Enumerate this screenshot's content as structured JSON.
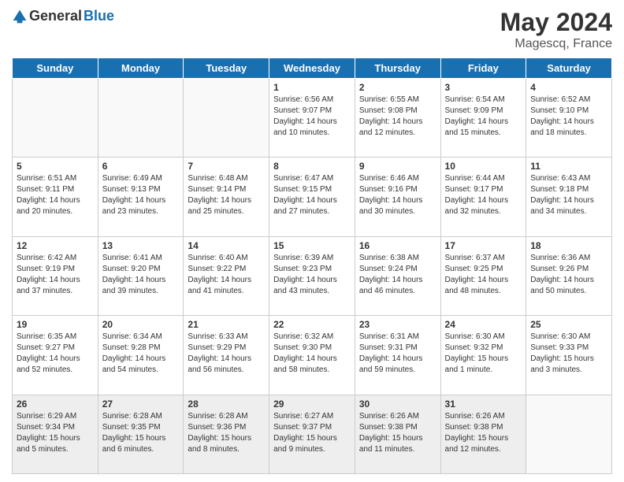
{
  "header": {
    "logo_general": "General",
    "logo_blue": "Blue",
    "month_title": "May 2024",
    "location": "Magescq, France"
  },
  "days_of_week": [
    "Sunday",
    "Monday",
    "Tuesday",
    "Wednesday",
    "Thursday",
    "Friday",
    "Saturday"
  ],
  "weeks": [
    [
      {
        "day": "",
        "info": ""
      },
      {
        "day": "",
        "info": ""
      },
      {
        "day": "",
        "info": ""
      },
      {
        "day": "1",
        "info": "Sunrise: 6:56 AM\nSunset: 9:07 PM\nDaylight: 14 hours\nand 10 minutes."
      },
      {
        "day": "2",
        "info": "Sunrise: 6:55 AM\nSunset: 9:08 PM\nDaylight: 14 hours\nand 12 minutes."
      },
      {
        "day": "3",
        "info": "Sunrise: 6:54 AM\nSunset: 9:09 PM\nDaylight: 14 hours\nand 15 minutes."
      },
      {
        "day": "4",
        "info": "Sunrise: 6:52 AM\nSunset: 9:10 PM\nDaylight: 14 hours\nand 18 minutes."
      }
    ],
    [
      {
        "day": "5",
        "info": "Sunrise: 6:51 AM\nSunset: 9:11 PM\nDaylight: 14 hours\nand 20 minutes."
      },
      {
        "day": "6",
        "info": "Sunrise: 6:49 AM\nSunset: 9:13 PM\nDaylight: 14 hours\nand 23 minutes."
      },
      {
        "day": "7",
        "info": "Sunrise: 6:48 AM\nSunset: 9:14 PM\nDaylight: 14 hours\nand 25 minutes."
      },
      {
        "day": "8",
        "info": "Sunrise: 6:47 AM\nSunset: 9:15 PM\nDaylight: 14 hours\nand 27 minutes."
      },
      {
        "day": "9",
        "info": "Sunrise: 6:46 AM\nSunset: 9:16 PM\nDaylight: 14 hours\nand 30 minutes."
      },
      {
        "day": "10",
        "info": "Sunrise: 6:44 AM\nSunset: 9:17 PM\nDaylight: 14 hours\nand 32 minutes."
      },
      {
        "day": "11",
        "info": "Sunrise: 6:43 AM\nSunset: 9:18 PM\nDaylight: 14 hours\nand 34 minutes."
      }
    ],
    [
      {
        "day": "12",
        "info": "Sunrise: 6:42 AM\nSunset: 9:19 PM\nDaylight: 14 hours\nand 37 minutes."
      },
      {
        "day": "13",
        "info": "Sunrise: 6:41 AM\nSunset: 9:20 PM\nDaylight: 14 hours\nand 39 minutes."
      },
      {
        "day": "14",
        "info": "Sunrise: 6:40 AM\nSunset: 9:22 PM\nDaylight: 14 hours\nand 41 minutes."
      },
      {
        "day": "15",
        "info": "Sunrise: 6:39 AM\nSunset: 9:23 PM\nDaylight: 14 hours\nand 43 minutes."
      },
      {
        "day": "16",
        "info": "Sunrise: 6:38 AM\nSunset: 9:24 PM\nDaylight: 14 hours\nand 46 minutes."
      },
      {
        "day": "17",
        "info": "Sunrise: 6:37 AM\nSunset: 9:25 PM\nDaylight: 14 hours\nand 48 minutes."
      },
      {
        "day": "18",
        "info": "Sunrise: 6:36 AM\nSunset: 9:26 PM\nDaylight: 14 hours\nand 50 minutes."
      }
    ],
    [
      {
        "day": "19",
        "info": "Sunrise: 6:35 AM\nSunset: 9:27 PM\nDaylight: 14 hours\nand 52 minutes."
      },
      {
        "day": "20",
        "info": "Sunrise: 6:34 AM\nSunset: 9:28 PM\nDaylight: 14 hours\nand 54 minutes."
      },
      {
        "day": "21",
        "info": "Sunrise: 6:33 AM\nSunset: 9:29 PM\nDaylight: 14 hours\nand 56 minutes."
      },
      {
        "day": "22",
        "info": "Sunrise: 6:32 AM\nSunset: 9:30 PM\nDaylight: 14 hours\nand 58 minutes."
      },
      {
        "day": "23",
        "info": "Sunrise: 6:31 AM\nSunset: 9:31 PM\nDaylight: 14 hours\nand 59 minutes."
      },
      {
        "day": "24",
        "info": "Sunrise: 6:30 AM\nSunset: 9:32 PM\nDaylight: 15 hours\nand 1 minute."
      },
      {
        "day": "25",
        "info": "Sunrise: 6:30 AM\nSunset: 9:33 PM\nDaylight: 15 hours\nand 3 minutes."
      }
    ],
    [
      {
        "day": "26",
        "info": "Sunrise: 6:29 AM\nSunset: 9:34 PM\nDaylight: 15 hours\nand 5 minutes."
      },
      {
        "day": "27",
        "info": "Sunrise: 6:28 AM\nSunset: 9:35 PM\nDaylight: 15 hours\nand 6 minutes."
      },
      {
        "day": "28",
        "info": "Sunrise: 6:28 AM\nSunset: 9:36 PM\nDaylight: 15 hours\nand 8 minutes."
      },
      {
        "day": "29",
        "info": "Sunrise: 6:27 AM\nSunset: 9:37 PM\nDaylight: 15 hours\nand 9 minutes."
      },
      {
        "day": "30",
        "info": "Sunrise: 6:26 AM\nSunset: 9:38 PM\nDaylight: 15 hours\nand 11 minutes."
      },
      {
        "day": "31",
        "info": "Sunrise: 6:26 AM\nSunset: 9:38 PM\nDaylight: 15 hours\nand 12 minutes."
      },
      {
        "day": "",
        "info": ""
      }
    ]
  ]
}
